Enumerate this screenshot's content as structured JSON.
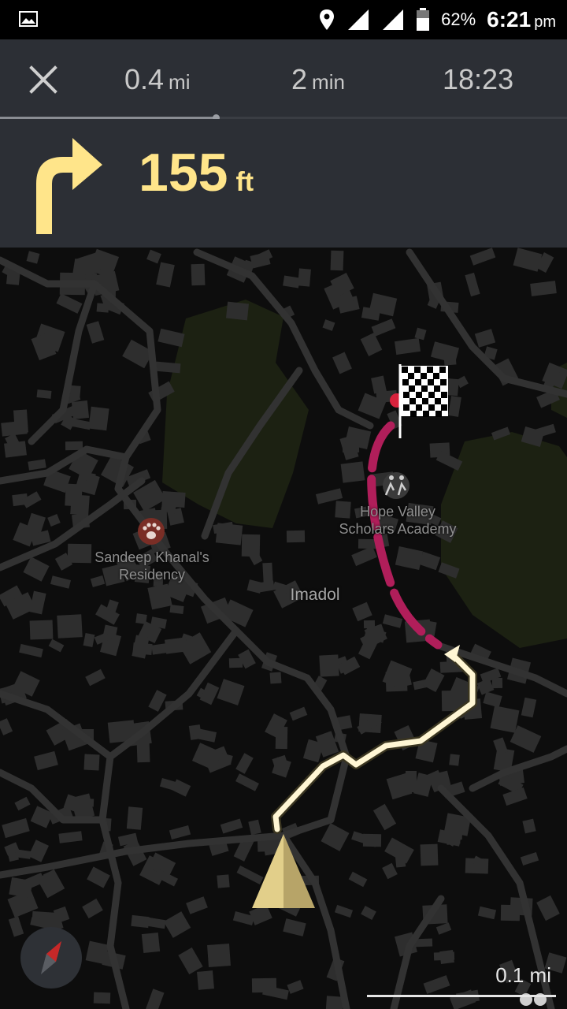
{
  "status_bar": {
    "battery_percent": "62%",
    "time": "6:21",
    "ampm": "pm"
  },
  "nav": {
    "distance_value": "0.4",
    "distance_unit": "mi",
    "duration_value": "2",
    "duration_unit": "min",
    "arrival_time": "18:23",
    "route_progress": 0.38
  },
  "turn": {
    "direction_icon": "turn-right-icon",
    "distance_value": "155",
    "distance_unit": "ft"
  },
  "map": {
    "poi_school_name": "Hope Valley Scholars Academy",
    "poi_school_line1": "Hope Valley",
    "poi_school_line2": "Scholars Academy",
    "poi_residence_line1": "Sandeep Khanal's",
    "poi_residence_line2": "Residency",
    "area_label": "Imadol",
    "scale_label": "0.1 mi",
    "route_traveled_color": "#fff6d4",
    "route_remaining_color": "#b01e5a",
    "park_color": "#1c2112",
    "building_color": "#2e2e2e",
    "road_color": "#323232"
  },
  "colors": {
    "panel_bg": "#2c2f35",
    "turn_accent": "#ffe58a",
    "text_muted": "#c9c9c9"
  }
}
